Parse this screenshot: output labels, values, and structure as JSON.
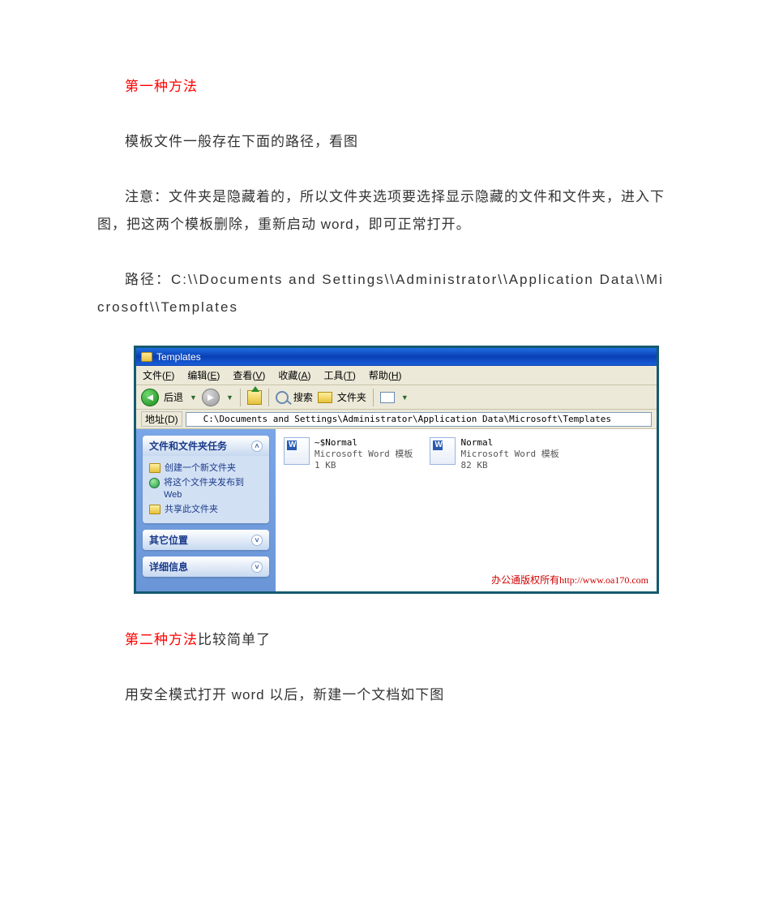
{
  "doc": {
    "method1_title": "第一种方法",
    "p1": "模板文件一般存在下面的路径，看图",
    "p2": "注意：文件夹是隐藏着的，所以文件夹选项要选择显示隐藏的文件和文件夹，进入下图，把这两个模板删除，重新启动 word，即可正常打开。",
    "p3_prefix": "路径：",
    "p3_path": "C:\\\\Documents and Settings\\\\Administrator\\\\Application Data\\\\Microsoft\\\\Templates",
    "method2_title": "第二种方法",
    "method2_suffix": "比较简单了",
    "p4": "用安全模式打开 word 以后，新建一个文档如下图"
  },
  "xp": {
    "title": "Templates",
    "menu": {
      "file": {
        "text": "文件",
        "accel": "F"
      },
      "edit": {
        "text": "编辑",
        "accel": "E"
      },
      "view": {
        "text": "查看",
        "accel": "V"
      },
      "fav": {
        "text": "收藏",
        "accel": "A"
      },
      "tools": {
        "text": "工具",
        "accel": "T"
      },
      "help": {
        "text": "帮助",
        "accel": "H"
      }
    },
    "toolbar": {
      "back": "后退",
      "search": "搜索",
      "folders": "文件夹"
    },
    "address_label": "地址(D)",
    "address_value": "C:\\Documents and Settings\\Administrator\\Application Data\\Microsoft\\Templates",
    "side": {
      "tasks_title": "文件和文件夹任务",
      "task_new": "创建一个新文件夹",
      "task_publish": "将这个文件夹发布到 Web",
      "task_share": "共享此文件夹",
      "other_title": "其它位置",
      "details_title": "详细信息"
    },
    "files": [
      {
        "name": "~$Normal",
        "type": "Microsoft Word 模板",
        "size": "1 KB"
      },
      {
        "name": "Normal",
        "type": "Microsoft Word 模板",
        "size": "82 KB"
      }
    ],
    "watermark_text": "办公通版权所有http://www.oa170.com"
  }
}
